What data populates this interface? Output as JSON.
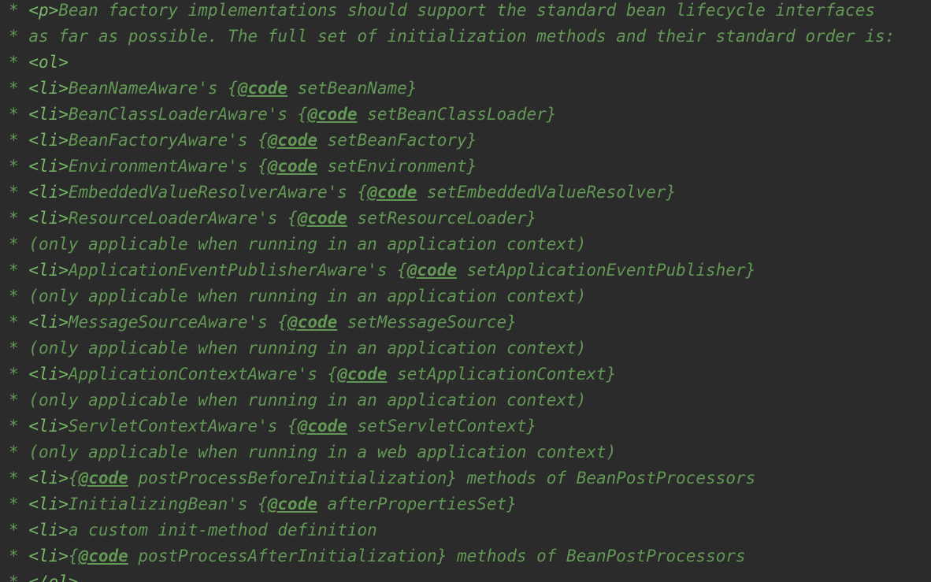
{
  "editor": {
    "language": "Java Javadoc comment",
    "colors": {
      "background": "#2b2b2b",
      "comment_text": "#629755",
      "html_tag": "#77b767"
    },
    "lines": [
      {
        "star": "*",
        "segments": [
          {
            "k": "tag",
            "t": "<p>"
          },
          {
            "k": "text",
            "t": "Bean factory implementations should support the standard bean lifecycle interfaces"
          }
        ]
      },
      {
        "star": "*",
        "segments": [
          {
            "k": "text",
            "t": "as far as possible. The full set of initialization methods and their standard order is:"
          }
        ]
      },
      {
        "star": "*",
        "segments": [
          {
            "k": "tag",
            "t": "<ol>"
          }
        ]
      },
      {
        "star": "*",
        "segments": [
          {
            "k": "tag",
            "t": "<li>"
          },
          {
            "k": "text",
            "t": "BeanNameAware's {"
          },
          {
            "k": "doctag",
            "t": "@code"
          },
          {
            "k": "text",
            "t": " setBeanName}"
          }
        ]
      },
      {
        "star": "*",
        "segments": [
          {
            "k": "tag",
            "t": "<li>"
          },
          {
            "k": "text",
            "t": "BeanClassLoaderAware's {"
          },
          {
            "k": "doctag",
            "t": "@code"
          },
          {
            "k": "text",
            "t": " setBeanClassLoader}"
          }
        ]
      },
      {
        "star": "*",
        "segments": [
          {
            "k": "tag",
            "t": "<li>"
          },
          {
            "k": "text",
            "t": "BeanFactoryAware's {"
          },
          {
            "k": "doctag",
            "t": "@code"
          },
          {
            "k": "text",
            "t": " setBeanFactory}"
          }
        ]
      },
      {
        "star": "*",
        "segments": [
          {
            "k": "tag",
            "t": "<li>"
          },
          {
            "k": "text",
            "t": "EnvironmentAware's {"
          },
          {
            "k": "doctag",
            "t": "@code"
          },
          {
            "k": "text",
            "t": " setEnvironment}"
          }
        ]
      },
      {
        "star": "*",
        "segments": [
          {
            "k": "tag",
            "t": "<li>"
          },
          {
            "k": "text",
            "t": "EmbeddedValueResolverAware's {"
          },
          {
            "k": "doctag",
            "t": "@code"
          },
          {
            "k": "text",
            "t": " setEmbeddedValueResolver}"
          }
        ]
      },
      {
        "star": "*",
        "segments": [
          {
            "k": "tag",
            "t": "<li>"
          },
          {
            "k": "text",
            "t": "ResourceLoaderAware's {"
          },
          {
            "k": "doctag",
            "t": "@code"
          },
          {
            "k": "text",
            "t": " setResourceLoader}"
          }
        ]
      },
      {
        "star": "*",
        "segments": [
          {
            "k": "text",
            "t": "(only applicable when running in an application context)"
          }
        ]
      },
      {
        "star": "*",
        "segments": [
          {
            "k": "tag",
            "t": "<li>"
          },
          {
            "k": "text",
            "t": "ApplicationEventPublisherAware's {"
          },
          {
            "k": "doctag",
            "t": "@code"
          },
          {
            "k": "text",
            "t": " setApplicationEventPublisher}"
          }
        ]
      },
      {
        "star": "*",
        "segments": [
          {
            "k": "text",
            "t": "(only applicable when running in an application context)"
          }
        ]
      },
      {
        "star": "*",
        "segments": [
          {
            "k": "tag",
            "t": "<li>"
          },
          {
            "k": "text",
            "t": "MessageSourceAware's {"
          },
          {
            "k": "doctag",
            "t": "@code"
          },
          {
            "k": "text",
            "t": " setMessageSource}"
          }
        ]
      },
      {
        "star": "*",
        "segments": [
          {
            "k": "text",
            "t": "(only applicable when running in an application context)"
          }
        ]
      },
      {
        "star": "*",
        "segments": [
          {
            "k": "tag",
            "t": "<li>"
          },
          {
            "k": "text",
            "t": "ApplicationContextAware's {"
          },
          {
            "k": "doctag",
            "t": "@code"
          },
          {
            "k": "text",
            "t": " setApplicationContext}"
          }
        ]
      },
      {
        "star": "*",
        "segments": [
          {
            "k": "text",
            "t": "(only applicable when running in an application context)"
          }
        ]
      },
      {
        "star": "*",
        "segments": [
          {
            "k": "tag",
            "t": "<li>"
          },
          {
            "k": "text",
            "t": "ServletContextAware's {"
          },
          {
            "k": "doctag",
            "t": "@code"
          },
          {
            "k": "text",
            "t": " setServletContext}"
          }
        ]
      },
      {
        "star": "*",
        "segments": [
          {
            "k": "text",
            "t": "(only applicable when running in a web application context)"
          }
        ]
      },
      {
        "star": "*",
        "segments": [
          {
            "k": "tag",
            "t": "<li>"
          },
          {
            "k": "text",
            "t": "{"
          },
          {
            "k": "doctag",
            "t": "@code"
          },
          {
            "k": "text",
            "t": " postProcessBeforeInitialization} methods of BeanPostProcessors"
          }
        ]
      },
      {
        "star": "*",
        "segments": [
          {
            "k": "tag",
            "t": "<li>"
          },
          {
            "k": "text",
            "t": "InitializingBean's {"
          },
          {
            "k": "doctag",
            "t": "@code"
          },
          {
            "k": "text",
            "t": " afterPropertiesSet}"
          }
        ]
      },
      {
        "star": "*",
        "segments": [
          {
            "k": "tag",
            "t": "<li>"
          },
          {
            "k": "text",
            "t": "a custom init-method definition"
          }
        ]
      },
      {
        "star": "*",
        "segments": [
          {
            "k": "tag",
            "t": "<li>"
          },
          {
            "k": "text",
            "t": "{"
          },
          {
            "k": "doctag",
            "t": "@code"
          },
          {
            "k": "text",
            "t": " postProcessAfterInitialization} methods of BeanPostProcessors"
          }
        ]
      },
      {
        "star": "*",
        "segments": [
          {
            "k": "tag",
            "t": "</ol>"
          }
        ]
      }
    ]
  }
}
